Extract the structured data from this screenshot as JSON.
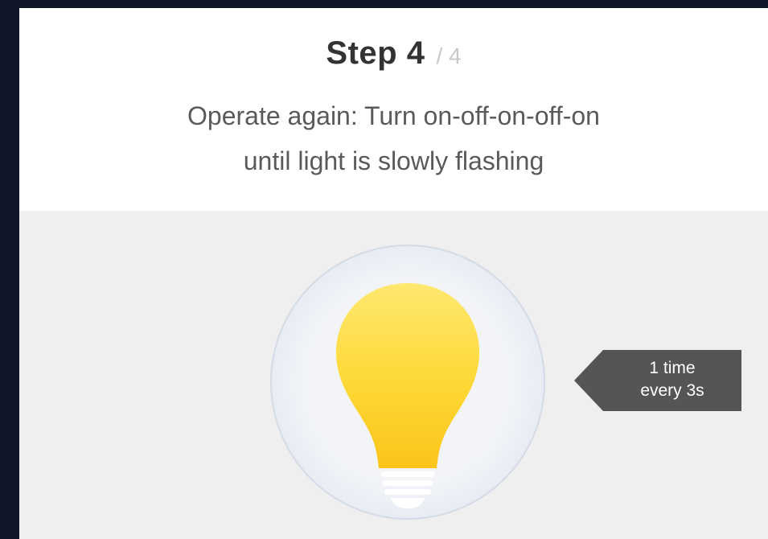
{
  "step": {
    "label": "Step 4",
    "total": "/ 4"
  },
  "instruction": {
    "line1": "Operate again: Turn on-off-on-off-on",
    "line2": "until light is slowly flashing"
  },
  "indicator": {
    "line1": "1 time",
    "line2": "every 3s",
    "color": "#555555"
  },
  "bulb": {
    "icon": "light-bulb-icon",
    "color": "#fdd835"
  }
}
